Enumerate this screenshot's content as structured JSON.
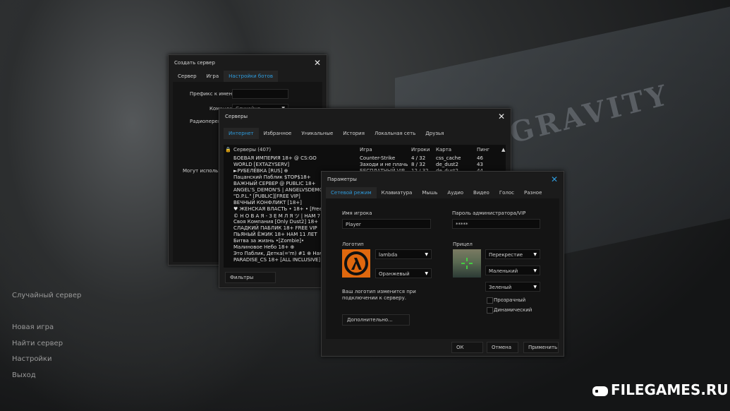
{
  "background": {
    "logo_text": "GRAVITY",
    "watermark": "FILEGAMES.RU"
  },
  "main_menu": {
    "random_server": "Случайный сервер",
    "new_game": "Новая игра",
    "find_server": "Найти сервер",
    "settings": "Настройки",
    "exit": "Выход"
  },
  "create_server": {
    "title": "Создать сервер",
    "tabs": [
      "Сервер",
      "Игра",
      "Настройки ботов"
    ],
    "active_tab": "Настройки ботов",
    "name_prefix_label": "Префикс к имени",
    "team_label": "Команда",
    "team_value": "Случайно",
    "radio_label": "Радиоперегов",
    "can_use_label": "Могут использов"
  },
  "servers": {
    "title": "Серверы",
    "tabs": [
      "Интернет",
      "Избранное",
      "Уникальные",
      "История",
      "Локальная сеть",
      "Друзья"
    ],
    "active_tab": "Интернет",
    "columns": {
      "name": "Серверы (407)",
      "game": "Игра",
      "players": "Игроки",
      "map": "Карта",
      "ping": "Пинг"
    },
    "rows": [
      {
        "name": "БОЕВАЯ ИМПЕРИЯ 18+ @ CS:GO",
        "game": "Counter-Strike",
        "players": "4 / 32",
        "map": "css_cache",
        "ping": "46"
      },
      {
        "name": "WORLD [EXTAZYSERV]",
        "game": "Заходи и не плачь",
        "players": "8 / 32",
        "map": "de_dust2",
        "ping": "43"
      },
      {
        "name": "►РУБЕЛЁВКА [RUS] ⊕",
        "game": "БЕСПЛАТНЫЙ VIP",
        "players": "12 / 32",
        "map": "de_dust2",
        "ping": "44"
      },
      {
        "name": "Пацанский Паблик $TOP$18+",
        "game": "",
        "players": "",
        "map": "",
        "ping": ""
      },
      {
        "name": "ВАЖНЫЙ СЕРВЕР @ PUBLIC 18+",
        "game": "",
        "players": "",
        "map": "",
        "ping": ""
      },
      {
        "name": "ANGEL'S_DEMON'S | ANGELVSDEMON.RU",
        "game": "",
        "players": "",
        "map": "",
        "ping": ""
      },
      {
        "name": "\"D.P.L.\" [PUBLIC][FREE VIP]",
        "game": "",
        "players": "",
        "map": "",
        "ping": ""
      },
      {
        "name": "ВЕЧНЫЙ КОНФЛИКТ [18+]",
        "game": "",
        "players": "",
        "map": "",
        "ping": ""
      },
      {
        "name": "♥ ЖЕНСКАЯ ВЛАСТЬ • 18+ • [Free VIP]",
        "game": "",
        "players": "",
        "map": "",
        "ping": ""
      },
      {
        "name": "© Н О В А Я - З Е М Л Я ツ | НАМ 7 ЛЕТ",
        "game": "",
        "players": "",
        "map": "",
        "ping": ""
      },
      {
        "name": "Своя Компания [Only Dust2] 18+",
        "game": "",
        "players": "",
        "map": "",
        "ping": ""
      },
      {
        "name": "СЛАДКИЙ ПАБЛИК 18+ FREE VIP",
        "game": "",
        "players": "",
        "map": "",
        "ping": ""
      },
      {
        "name": "ПЬЯНЫЙ ЁЖИК 18+ НАМ 11 ЛЕТ",
        "game": "",
        "players": "",
        "map": "",
        "ping": ""
      },
      {
        "name": "Битва за жизнь •[Zombie]•",
        "game": "",
        "players": "",
        "map": "",
        "ping": ""
      },
      {
        "name": "Малиновое Небо 18+ ⊕",
        "game": "",
        "players": "",
        "map": "",
        "ping": ""
      },
      {
        "name": "Это Паблик, Детка(='m) #1 ⊕ Нам 7 ЛЕТ",
        "game": "",
        "players": "",
        "map": "",
        "ping": ""
      },
      {
        "name": "PARADISE_CS 18+ [ALL INCLUSIVE]",
        "game": "",
        "players": "",
        "map": "",
        "ping": ""
      }
    ],
    "filters_button": "Фильтры"
  },
  "options": {
    "title": "Параметры",
    "tabs": [
      "Сетевой режим",
      "Клавиатура",
      "Мышь",
      "Аудио",
      "Видео",
      "Голос",
      "Разное"
    ],
    "active_tab": "Сетевой режим",
    "player_name_label": "Имя игрока",
    "player_name_value": "Player",
    "admin_password_label": "Пароль администратора/VIP",
    "admin_password_value": "*****",
    "logo_label": "Логотип",
    "logo_select": "lambda",
    "logo_color": "Оранжевый",
    "crosshair_label": "Прицел",
    "crosshair_type": "Перекрестие",
    "crosshair_size": "Маленький",
    "crosshair_color": "Зеленый",
    "transparent_label": "Прозрачный",
    "dynamic_label": "Динамический",
    "logo_note": "Ваш логотип изменится при подключении к серверу.",
    "advanced_button": "Дополнительно...",
    "ok_button": "ОК",
    "cancel_button": "Отмена",
    "apply_button": "Применить",
    "colors": {
      "accent": "#2e9bdc",
      "logo_orange": "#e0680e"
    }
  }
}
